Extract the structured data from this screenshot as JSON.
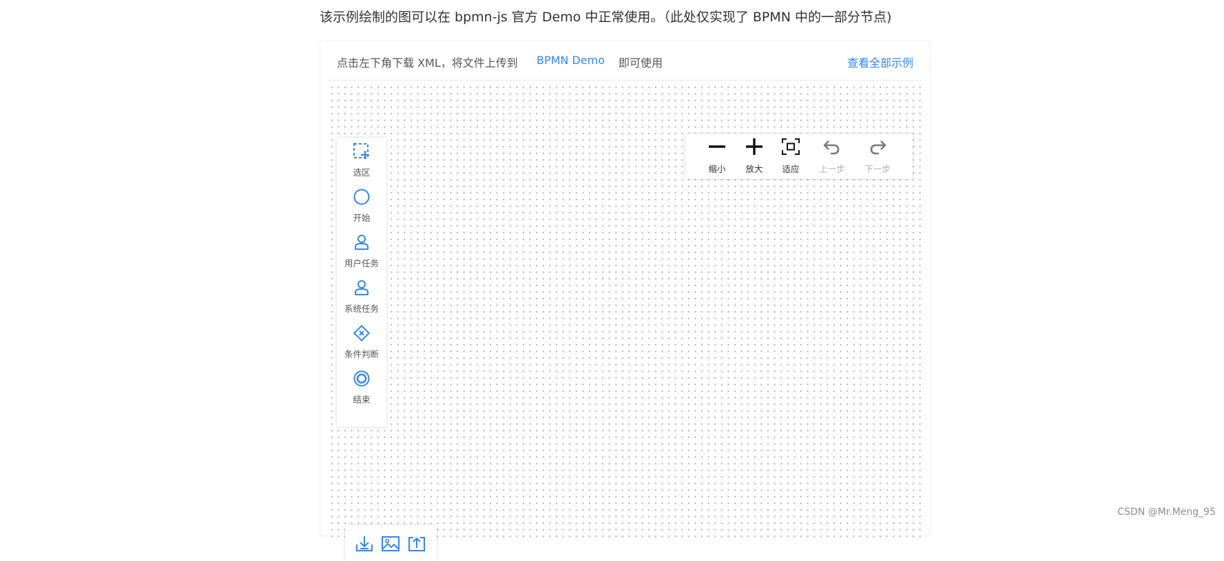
{
  "intro": {
    "text": "该示例绘制的图可以在 bpmn-js 官方 Demo 中正常使用。（此处仅实现了 BPMN 中的一部分节点)"
  },
  "header": {
    "text_before": "点击左下角下载 XML，将文件上传到",
    "demo_link": "BPMN Demo",
    "text_after": "即可使用",
    "all_examples_link": "查看全部示例"
  },
  "palette": {
    "items": [
      {
        "icon": "selection-icon",
        "label": "选区"
      },
      {
        "icon": "start-event-icon",
        "label": "开始"
      },
      {
        "icon": "user-task-icon",
        "label": "用户任务"
      },
      {
        "icon": "system-task-icon",
        "label": "系统任务"
      },
      {
        "icon": "gateway-icon",
        "label": "条件判断"
      },
      {
        "icon": "end-event-icon",
        "label": "结束"
      }
    ]
  },
  "toolbar": {
    "zoom_out": "缩小",
    "zoom_in": "放大",
    "fit": "适应",
    "undo": "上一步",
    "redo": "下一步"
  },
  "export": {
    "icons": [
      "download-xml-icon",
      "export-image-icon",
      "upload-icon"
    ]
  },
  "watermark": {
    "text": "CSDN @Mr.Meng_95"
  },
  "colors": {
    "accent": "#2f86f6",
    "disabled": "#b0b0b0",
    "text": "#555555"
  }
}
